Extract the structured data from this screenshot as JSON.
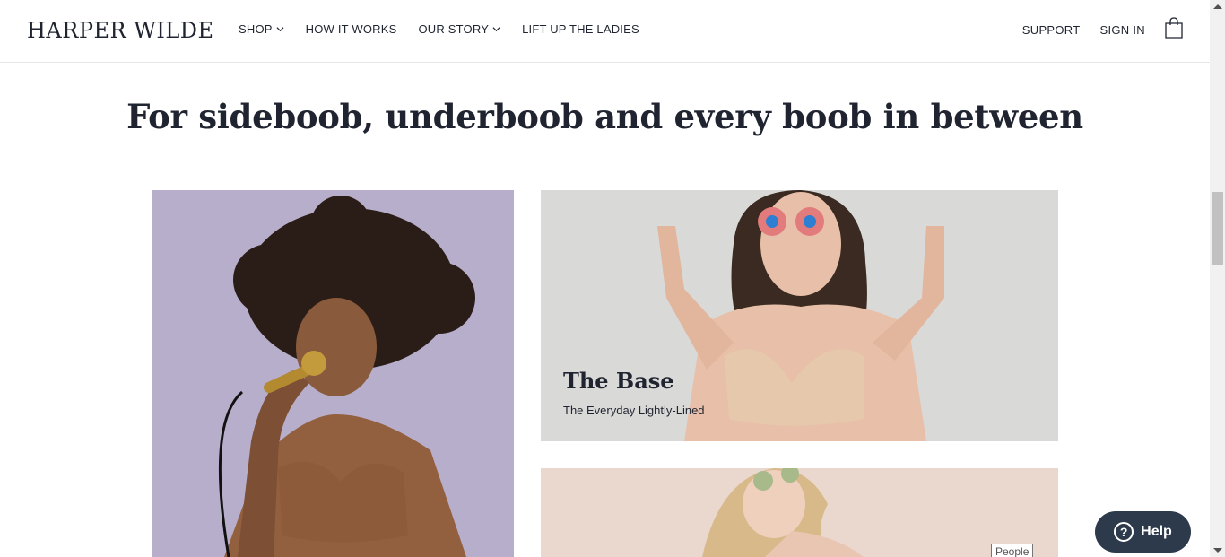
{
  "header": {
    "logo": "HARPER WILDE",
    "nav": [
      {
        "label": "SHOP",
        "dropdown": true
      },
      {
        "label": "HOW IT WORKS",
        "dropdown": false
      },
      {
        "label": "OUR STORY",
        "dropdown": true
      },
      {
        "label": "LIFT UP THE LADIES",
        "dropdown": false
      }
    ],
    "support": "SUPPORT",
    "sign_in": "SIGN IN"
  },
  "main": {
    "headline": "For sideboob, underboob and every boob in between",
    "tiles": {
      "top_right": {
        "title": "The Base",
        "subtitle": "The Everyday Lightly-Lined"
      }
    }
  },
  "tooltip": "People",
  "help": {
    "label": "Help",
    "icon": "?"
  },
  "colors": {
    "text": "#1f2430",
    "help_bg": "#2c3a4b",
    "tile_left_bg": "#b7aecb",
    "tile_top_bg": "#d9d9d7",
    "tile_bottom_bg": "#ead8cf"
  }
}
